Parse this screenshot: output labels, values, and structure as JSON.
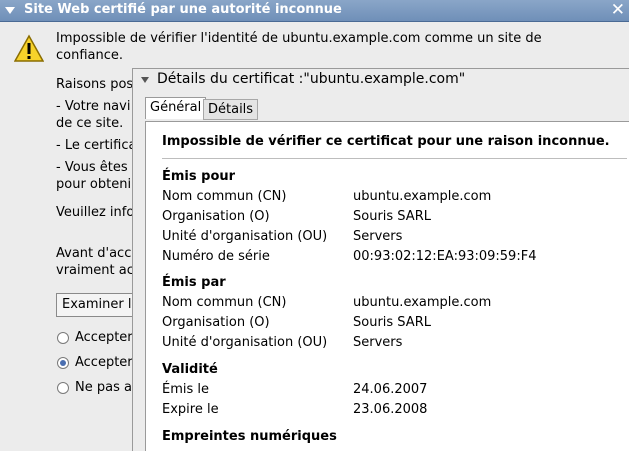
{
  "window": {
    "title": "Site Web certifié par une autorité inconnue",
    "close_glyph": "✕"
  },
  "dialog": {
    "message_line1": "Impossible de vérifier l'identité de ubuntu.example.com comme un site de",
    "message_line2": "confiance.",
    "reasons_intro": "Raisons pos",
    "reason1_line1": "- Votre navi",
    "reason1_line2": "de ce site.",
    "reason2": "- Le certifica",
    "reason3_line1": "- Vous êtes",
    "reason3_line2": "pour obtenir",
    "notify": "Veuillez info",
    "before_line1": "Avant d'acc",
    "before_line2": "vraiment ac",
    "examine_button": "Examiner l",
    "radios": [
      {
        "label": "Accepter",
        "selected": false
      },
      {
        "label": "Accepter",
        "selected": true
      },
      {
        "label": "Ne pas a",
        "selected": false
      }
    ]
  },
  "cert": {
    "header": "Détails du certificat :\"ubuntu.example.com\"",
    "tabs": [
      "Général",
      "Détails"
    ],
    "warning": "Impossible de vérifier ce certificat pour une raison inconnue.",
    "issued_to": {
      "heading": "Émis pour",
      "fields": [
        {
          "label": "Nom commun (CN)",
          "value": "ubuntu.example.com"
        },
        {
          "label": "Organisation (O)",
          "value": "Souris SARL"
        },
        {
          "label": "Unité d'organisation (OU)",
          "value": "Servers"
        },
        {
          "label": "Numéro de série",
          "value": "00:93:02:12:EA:93:09:59:F4"
        }
      ]
    },
    "issued_by": {
      "heading": "Émis par",
      "fields": [
        {
          "label": "Nom commun (CN)",
          "value": "ubuntu.example.com"
        },
        {
          "label": "Organisation (O)",
          "value": "Souris SARL"
        },
        {
          "label": "Unité d'organisation (OU)",
          "value": "Servers"
        }
      ]
    },
    "validity": {
      "heading": "Validité",
      "fields": [
        {
          "label": "Émis le",
          "value": "24.06.2007"
        },
        {
          "label": "Expire le",
          "value": "23.06.2008"
        }
      ]
    },
    "fingerprints": {
      "heading": "Empreintes numériques"
    }
  }
}
